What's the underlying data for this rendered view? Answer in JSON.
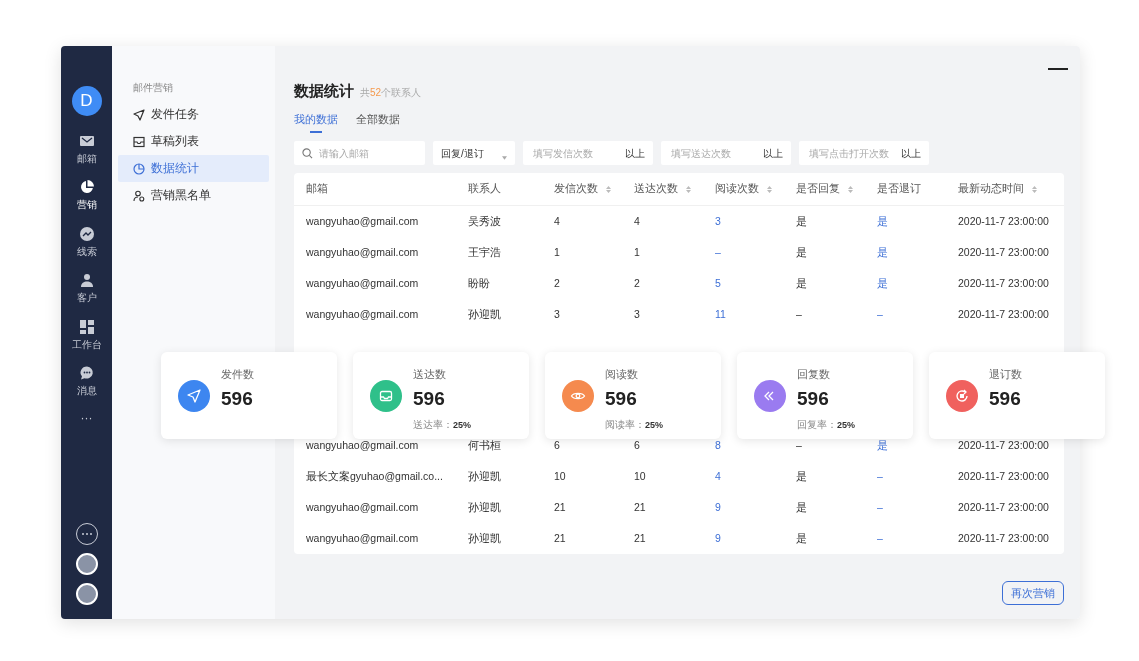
{
  "rail": {
    "avatar": "D",
    "items": [
      {
        "kind": "mail",
        "label": "邮箱",
        "selected": false
      },
      {
        "kind": "pie",
        "label": "营销",
        "selected": true
      },
      {
        "kind": "trend",
        "label": "线索",
        "selected": false
      },
      {
        "kind": "person",
        "label": "客户",
        "selected": false
      },
      {
        "kind": "grid",
        "label": "工作台",
        "selected": false
      },
      {
        "kind": "chat",
        "label": "消息",
        "selected": false
      }
    ],
    "more": "···"
  },
  "sidebar": {
    "section": "邮件营销",
    "items": [
      {
        "kind": "send",
        "label": "发件任务",
        "selected": false
      },
      {
        "kind": "inbox",
        "label": "草稿列表",
        "selected": false
      },
      {
        "kind": "pie",
        "label": "数据统计",
        "selected": true
      },
      {
        "kind": "people",
        "label": "营销黑名单",
        "selected": false
      }
    ]
  },
  "page": {
    "title": "数据统计",
    "subtitle": {
      "prefix": "共",
      "count": "52",
      "suffix": "个联系人"
    }
  },
  "tabs": [
    {
      "label": "我的数据",
      "selected": true
    },
    {
      "label": "全部数据",
      "selected": false
    }
  ],
  "filters": {
    "search": {
      "placeholder": "请输入邮箱"
    },
    "select": {
      "value": "回复/退订"
    },
    "numbers": [
      {
        "placeholder": "填写发信次数",
        "suffix": "以上"
      },
      {
        "placeholder": "填写送达次数",
        "suffix": "以上"
      },
      {
        "placeholder": "填写点击打开次数",
        "suffix": "以上"
      }
    ]
  },
  "table": {
    "columns": [
      {
        "label": "邮箱",
        "sortable": false,
        "kind": "text"
      },
      {
        "label": "联系人",
        "sortable": false,
        "kind": "text"
      },
      {
        "label": "发信次数",
        "sortable": true,
        "kind": "text"
      },
      {
        "label": "送达次数",
        "sortable": true,
        "kind": "text"
      },
      {
        "label": "阅读次数",
        "sortable": true,
        "kind": "link"
      },
      {
        "label": "是否回复",
        "sortable": true,
        "kind": "text"
      },
      {
        "label": "是否退订",
        "sortable": false,
        "kind": "link"
      },
      {
        "label": "最新动态时间",
        "sortable": true,
        "kind": "text"
      }
    ],
    "rows_above_cards": [
      [
        "wangyuhao@gmail.com",
        "吴秀波",
        "4",
        "4",
        "3",
        "是",
        "是",
        "2020-11-7 23:00:00"
      ],
      [
        "wangyuhao@gmail.com",
        "王宇浩",
        "1",
        "1",
        "–",
        "是",
        "是",
        "2020-11-7 23:00:00"
      ],
      [
        "wangyuhao@gmail.com",
        "盼盼",
        "2",
        "2",
        "5",
        "是",
        "是",
        "2020-11-7 23:00:00"
      ],
      [
        "wangyuhao@gmail.com",
        "孙迎凯",
        "3",
        "3",
        "11",
        "–",
        "–",
        "2020-11-7 23:00:00"
      ]
    ],
    "rows_below_cards": [
      [
        "wangyuhao@gmail.com",
        "何书桓",
        "6",
        "6",
        "8",
        "–",
        "是",
        "2020-11-7 23:00:00"
      ],
      [
        "最长文案gyuhao@gmail.co...",
        "孙迎凯",
        "10",
        "10",
        "4",
        "是",
        "–",
        "2020-11-7 23:00:00"
      ],
      [
        "wangyuhao@gmail.com",
        "孙迎凯",
        "21",
        "21",
        "9",
        "是",
        "–",
        "2020-11-7 23:00:00"
      ],
      [
        "wangyuhao@gmail.com",
        "孙迎凯",
        "21",
        "21",
        "9",
        "是",
        "–",
        "2020-11-7 23:00:00"
      ]
    ]
  },
  "stat_cards": [
    {
      "kind": "send",
      "title": "发件数",
      "value": "596",
      "color": "#3d86f0"
    },
    {
      "kind": "inbox",
      "title": "送达数",
      "value": "596",
      "color": "#2fc08a",
      "rate": {
        "label": "送达率：",
        "value": "25%"
      }
    },
    {
      "kind": "eye",
      "title": "阅读数",
      "value": "596",
      "color": "#f58a4e",
      "rate": {
        "label": "阅读率：",
        "value": "25%"
      }
    },
    {
      "kind": "reply",
      "title": "回复数",
      "value": "596",
      "color": "#9a7bf0",
      "rate": {
        "label": "回复率：",
        "value": "25%"
      }
    },
    {
      "kind": "unsubscribe",
      "title": "退订数",
      "value": "596",
      "color": "#f0615e"
    }
  ],
  "action_button": "再次营销"
}
